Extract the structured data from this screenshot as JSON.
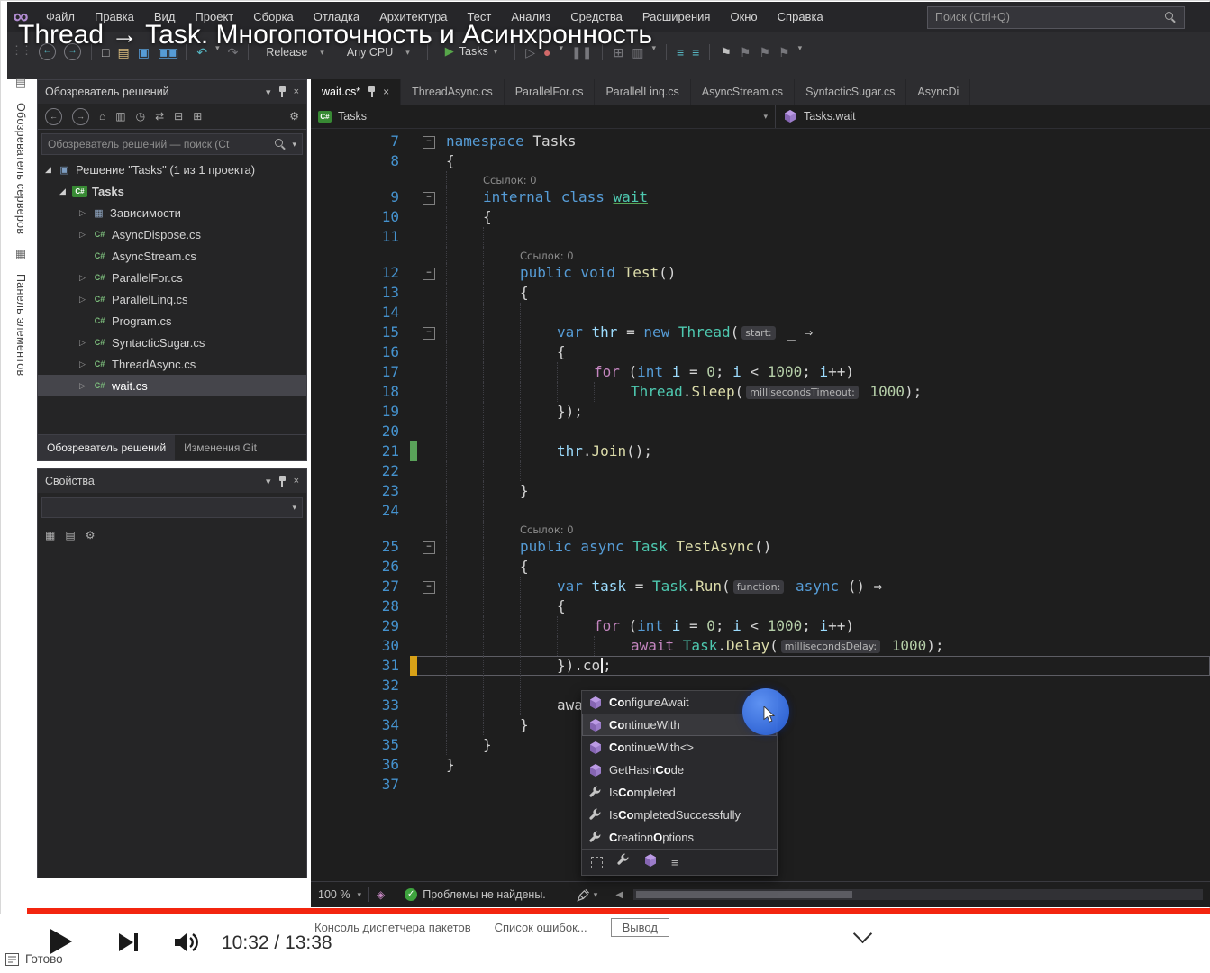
{
  "overlay_title": "Thread → Task. Многопоточность и Асинхронность",
  "window": {
    "search_placeholder": "Поиск (Ctrl+Q)"
  },
  "menu": [
    "Файл",
    "Правка",
    "Вид",
    "Проект",
    "Сборка",
    "Отладка",
    "Архитектура",
    "Тест",
    "Анализ",
    "Средства",
    "Расширения",
    "Окно",
    "Справка"
  ],
  "toolbar": {
    "config": "Release",
    "platform": "Any CPU",
    "start_label": "Tasks"
  },
  "left_tabs": [
    "Обозреватель серверов",
    "Панель элементов"
  ],
  "solution_explorer": {
    "title": "Обозреватель решений",
    "search": "Обозреватель решений — поиск (Ct",
    "root_label": "Решение \"Tasks\" (1 из 1 проекта)",
    "project_label": "Tasks",
    "children": [
      {
        "label": "Зависимости",
        "icon": "deps",
        "arrow": true
      },
      {
        "label": "AsyncDispose.cs",
        "icon": "cs",
        "arrow": true
      },
      {
        "label": "AsyncStream.cs",
        "icon": "cs",
        "arrow": false
      },
      {
        "label": "ParallelFor.cs",
        "icon": "cs",
        "arrow": true
      },
      {
        "label": "ParallelLinq.cs",
        "icon": "cs",
        "arrow": true
      },
      {
        "label": "Program.cs",
        "icon": "cs",
        "arrow": false
      },
      {
        "label": "SyntacticSugar.cs",
        "icon": "cs",
        "arrow": true
      },
      {
        "label": "ThreadAsync.cs",
        "icon": "cs",
        "arrow": true
      },
      {
        "label": "wait.cs",
        "icon": "cs",
        "arrow": true,
        "selected": true
      }
    ],
    "bottom_tabs": [
      {
        "label": "Обозреватель решений",
        "active": true
      },
      {
        "label": "Изменения Git",
        "active": false
      }
    ]
  },
  "properties": {
    "title": "Свойства"
  },
  "editor": {
    "tabs": [
      {
        "label": "wait.cs*",
        "active": true
      },
      {
        "label": "ThreadAsync.cs"
      },
      {
        "label": "ParallelFor.cs"
      },
      {
        "label": "ParallelLinq.cs"
      },
      {
        "label": "AsyncStream.cs"
      },
      {
        "label": "SyntacticSugar.cs"
      },
      {
        "label": "AsyncDi"
      }
    ],
    "breadcrumb_left": "Tasks",
    "breadcrumb_right": "Tasks.wait",
    "codelens": "Ссылок: 0",
    "zoom": "100 %",
    "health": "Проблемы не найдены.",
    "rows": [
      {
        "n": "7",
        "i": 0,
        "fold": true,
        "t": [
          [
            "kw",
            "namespace "
          ],
          [
            "pl",
            "Tasks"
          ]
        ]
      },
      {
        "n": "8",
        "i": 0,
        "t": [
          [
            "pl",
            "{"
          ]
        ]
      },
      {
        "cl": true,
        "i": 1
      },
      {
        "n": "9",
        "i": 1,
        "fold": true,
        "t": [
          [
            "kw",
            "internal class "
          ],
          [
            "tyu",
            "wait"
          ]
        ]
      },
      {
        "n": "10",
        "i": 1,
        "t": [
          [
            "pl",
            "{"
          ]
        ]
      },
      {
        "n": "11",
        "i": 2,
        "t": []
      },
      {
        "cl": true,
        "i": 2
      },
      {
        "n": "12",
        "i": 2,
        "fold": true,
        "t": [
          [
            "kw",
            "public void "
          ],
          [
            "fn",
            "Test"
          ],
          [
            "pl",
            "()"
          ]
        ]
      },
      {
        "n": "13",
        "i": 2,
        "t": [
          [
            "pl",
            "{"
          ]
        ]
      },
      {
        "n": "14",
        "i": 3,
        "t": []
      },
      {
        "n": "15",
        "i": 3,
        "fold": true,
        "t": [
          [
            "kw",
            "var "
          ],
          [
            "lv",
            "thr "
          ],
          [
            "pl",
            "= "
          ],
          [
            "kw",
            "new "
          ],
          [
            "ty",
            "Thread"
          ],
          [
            "pl",
            "("
          ],
          [
            "hint",
            "start:"
          ],
          [
            "pl",
            " _ ⇒"
          ]
        ]
      },
      {
        "n": "16",
        "i": 3,
        "t": [
          [
            "pl",
            "{"
          ]
        ]
      },
      {
        "n": "17",
        "i": 4,
        "t": [
          [
            "ctl",
            "for "
          ],
          [
            "pl",
            "("
          ],
          [
            "kw",
            "int "
          ],
          [
            "lv",
            "i"
          ],
          [
            "pl",
            " = "
          ],
          [
            "num",
            "0"
          ],
          [
            "pl",
            "; "
          ],
          [
            "lv",
            "i"
          ],
          [
            "pl",
            " < "
          ],
          [
            "num",
            "1000"
          ],
          [
            "pl",
            "; "
          ],
          [
            "lv",
            "i"
          ],
          [
            "pl",
            "++)"
          ]
        ]
      },
      {
        "n": "18",
        "i": 5,
        "t": [
          [
            "ty",
            "Thread"
          ],
          [
            "pl",
            "."
          ],
          [
            "fn",
            "Sleep"
          ],
          [
            "pl",
            "("
          ],
          [
            "hint",
            "millisecondsTimeout:"
          ],
          [
            "pl",
            " "
          ],
          [
            "num",
            "1000"
          ],
          [
            "pl",
            ");"
          ]
        ]
      },
      {
        "n": "19",
        "i": 3,
        "t": [
          [
            "pl",
            "});"
          ]
        ]
      },
      {
        "n": "20",
        "i": 3,
        "t": []
      },
      {
        "n": "21",
        "i": 3,
        "bar": "g",
        "t": [
          [
            "lv",
            "thr"
          ],
          [
            "pl",
            "."
          ],
          [
            "fn",
            "Join"
          ],
          [
            "pl",
            "();"
          ]
        ]
      },
      {
        "n": "22",
        "i": 3,
        "t": []
      },
      {
        "n": "23",
        "i": 2,
        "t": [
          [
            "pl",
            "}"
          ]
        ]
      },
      {
        "n": "24",
        "i": 2,
        "t": []
      },
      {
        "cl": true,
        "i": 2
      },
      {
        "n": "25",
        "i": 2,
        "fold": true,
        "t": [
          [
            "kw",
            "public async "
          ],
          [
            "ty",
            "Task "
          ],
          [
            "fn",
            "TestAsync"
          ],
          [
            "pl",
            "()"
          ]
        ]
      },
      {
        "n": "26",
        "i": 2,
        "t": [
          [
            "pl",
            "{"
          ]
        ]
      },
      {
        "n": "27",
        "i": 3,
        "fold": true,
        "t": [
          [
            "kw",
            "var "
          ],
          [
            "lv",
            "task "
          ],
          [
            "pl",
            "= "
          ],
          [
            "ty",
            "Task"
          ],
          [
            "pl",
            "."
          ],
          [
            "fn",
            "Run"
          ],
          [
            "pl",
            "("
          ],
          [
            "hint",
            "function:"
          ],
          [
            "pl",
            " "
          ],
          [
            "kw",
            "async "
          ],
          [
            "pl",
            "() ⇒"
          ]
        ]
      },
      {
        "n": "28",
        "i": 3,
        "t": [
          [
            "pl",
            "{"
          ]
        ]
      },
      {
        "n": "29",
        "i": 4,
        "t": [
          [
            "ctl",
            "for "
          ],
          [
            "pl",
            "("
          ],
          [
            "kw",
            "int "
          ],
          [
            "lv",
            "i"
          ],
          [
            "pl",
            " = "
          ],
          [
            "num",
            "0"
          ],
          [
            "pl",
            "; "
          ],
          [
            "lv",
            "i"
          ],
          [
            "pl",
            " < "
          ],
          [
            "num",
            "1000"
          ],
          [
            "pl",
            "; "
          ],
          [
            "lv",
            "i"
          ],
          [
            "pl",
            "++)"
          ]
        ]
      },
      {
        "n": "30",
        "i": 5,
        "t": [
          [
            "ctl",
            "await "
          ],
          [
            "ty",
            "Task"
          ],
          [
            "pl",
            "."
          ],
          [
            "fn",
            "Delay"
          ],
          [
            "pl",
            "("
          ],
          [
            "hint",
            "millisecondsDelay:"
          ],
          [
            "pl",
            " "
          ],
          [
            "num",
            "1000"
          ],
          [
            "pl",
            ");"
          ]
        ]
      },
      {
        "n": "31",
        "i": 3,
        "bar": "y",
        "cur": true,
        "t": [
          [
            "pl",
            "})."
          ],
          [
            "pl",
            "co"
          ],
          [
            "caret",
            ""
          ],
          [
            "pl",
            ";"
          ]
        ]
      },
      {
        "n": "32",
        "i": 3,
        "t": []
      },
      {
        "n": "33",
        "i": 3,
        "t": [
          [
            "pl",
            "awa"
          ]
        ]
      },
      {
        "n": "34",
        "i": 2,
        "t": [
          [
            "pl",
            "}"
          ]
        ]
      },
      {
        "n": "35",
        "i": 1,
        "t": [
          [
            "pl",
            "}"
          ]
        ]
      },
      {
        "n": "36",
        "i": 0,
        "t": [
          [
            "pl",
            "}"
          ]
        ]
      },
      {
        "n": "37",
        "i": 0,
        "t": []
      }
    ]
  },
  "intellisense": {
    "items": [
      {
        "icon": "method",
        "parts": [
          [
            "b",
            "Co"
          ],
          [
            "r",
            "nfigureAwait"
          ]
        ]
      },
      {
        "icon": "method",
        "selected": true,
        "parts": [
          [
            "b",
            "Co"
          ],
          [
            "r",
            "ntinueWith"
          ]
        ]
      },
      {
        "icon": "method",
        "parts": [
          [
            "b",
            "Co"
          ],
          [
            "r",
            "ntinueWith<>"
          ]
        ]
      },
      {
        "icon": "method",
        "parts": [
          [
            "r",
            "GetHash"
          ],
          [
            "b",
            "Co"
          ],
          [
            "r",
            "de"
          ]
        ]
      },
      {
        "icon": "prop",
        "parts": [
          [
            "r",
            "Is"
          ],
          [
            "b",
            "Co"
          ],
          [
            "r",
            "mpleted"
          ]
        ]
      },
      {
        "icon": "prop",
        "parts": [
          [
            "r",
            "Is"
          ],
          [
            "b",
            "Co"
          ],
          [
            "r",
            "mpletedSuccessfully"
          ]
        ]
      },
      {
        "icon": "prop",
        "parts": [
          [
            "b",
            "C"
          ],
          [
            "r",
            "reation"
          ],
          [
            "b",
            "O"
          ],
          [
            "r",
            "ptions"
          ]
        ]
      }
    ]
  },
  "bottom_panel_tabs": [
    {
      "label": "Консоль диспетчера пакетов"
    },
    {
      "label": "Список ошибок..."
    },
    {
      "label": "Вывод",
      "boxed": true
    }
  ],
  "player": {
    "time": "10:32 / 13:38"
  },
  "statusbar": {
    "ready": "Готово"
  }
}
